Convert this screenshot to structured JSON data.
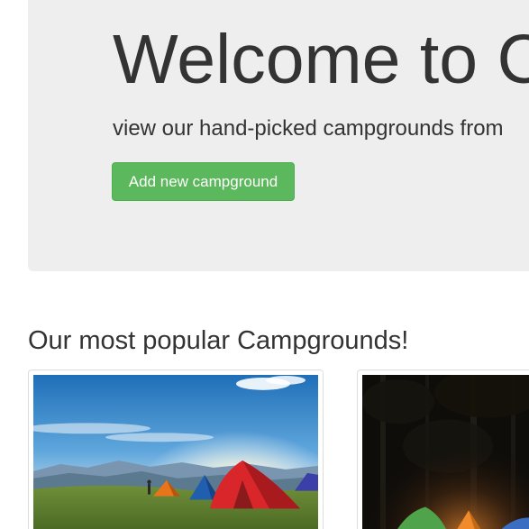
{
  "jumbotron": {
    "title": "Welcome to C",
    "lead": "view our hand-picked campgrounds from",
    "add_button_label": "Add new campground"
  },
  "campgrounds_section": {
    "heading": "Our most popular Campgrounds!",
    "cards": [
      {
        "image_description": "colorful tents on a green hillside under a blue sky"
      },
      {
        "image_description": "glowing tents in a dark forest at night"
      }
    ]
  },
  "colors": {
    "jumbotron_bg": "#eeeeee",
    "button_green": "#5cb85c",
    "text": "#333333"
  }
}
